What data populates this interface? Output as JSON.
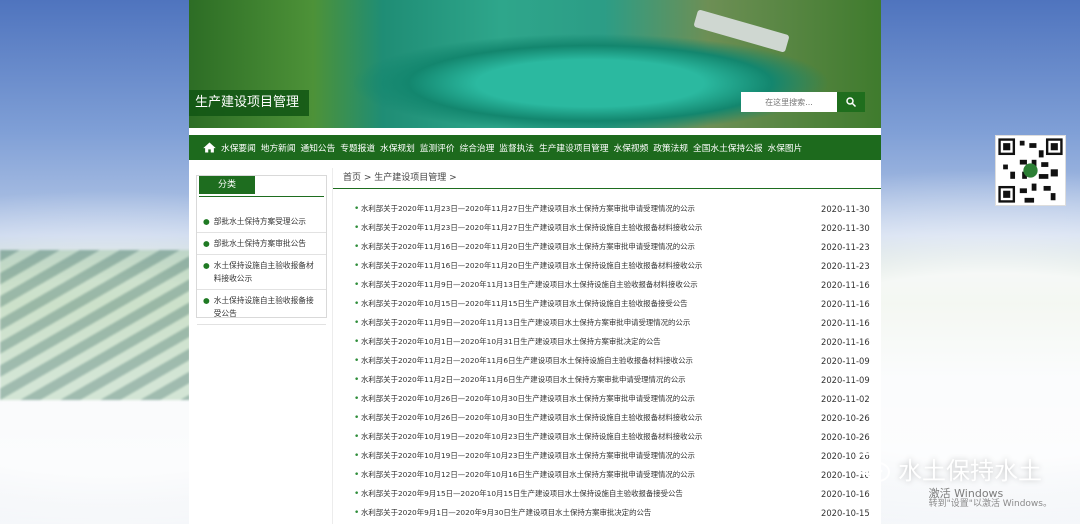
{
  "site": {
    "title": "生产建设项目管理",
    "search_placeholder": "在这里搜索...",
    "search_button_label": "🔍"
  },
  "nav": {
    "items": [
      {
        "label": "水保要闻"
      },
      {
        "label": "地方新闻"
      },
      {
        "label": "通知公告"
      },
      {
        "label": "专题报道"
      },
      {
        "label": "水保规划"
      },
      {
        "label": "监测评价"
      },
      {
        "label": "综合治理"
      },
      {
        "label": "监督执法"
      },
      {
        "label": "生产建设项目管理"
      },
      {
        "label": "水保视频"
      },
      {
        "label": "政策法规"
      },
      {
        "label": "全国水土保持公报"
      },
      {
        "label": "水保图片"
      }
    ]
  },
  "sidebar": {
    "header": "分类",
    "items": [
      {
        "label": "部批水土保持方案受理公示"
      },
      {
        "label": "部批水土保持方案审批公告"
      },
      {
        "label": "水土保持设施自主验收报备材料接收公示"
      },
      {
        "label": "水土保持设施自主验收报备接受公告"
      }
    ]
  },
  "breadcrumb": "首页 > 生产建设项目管理 >",
  "news": [
    {
      "title": "水利部关于2020年11月23日—2020年11月27日生产建设项目水土保持方案审批申请受理情况的公示",
      "date": "2020-11-30"
    },
    {
      "title": "水利部关于2020年11月23日—2020年11月27日生产建设项目水土保持设施自主验收报备材料接收公示",
      "date": "2020-11-30"
    },
    {
      "title": "水利部关于2020年11月16日—2020年11月20日生产建设项目水土保持方案审批申请受理情况的公示",
      "date": "2020-11-23"
    },
    {
      "title": "水利部关于2020年11月16日—2020年11月20日生产建设项目水土保持设施自主验收报备材料接收公示",
      "date": "2020-11-23"
    },
    {
      "title": "水利部关于2020年11月9日—2020年11月13日生产建设项目水土保持设施自主验收报备材料接收公示",
      "date": "2020-11-16"
    },
    {
      "title": "水利部关于2020年10月15日—2020年11月15日生产建设项目水土保持设施自主验收报备接受公告",
      "date": "2020-11-16"
    },
    {
      "title": "水利部关于2020年11月9日—2020年11月13日生产建设项目水土保持方案审批申请受理情况的公示",
      "date": "2020-11-16"
    },
    {
      "title": "水利部关于2020年10月1日—2020年10月31日生产建设项目水土保持方案审批决定的公告",
      "date": "2020-11-16"
    },
    {
      "title": "水利部关于2020年11月2日—2020年11月6日生产建设项目水土保持设施自主验收报备材料接收公示",
      "date": "2020-11-09"
    },
    {
      "title": "水利部关于2020年11月2日—2020年11月6日生产建设项目水土保持方案审批申请受理情况的公示",
      "date": "2020-11-09"
    },
    {
      "title": "水利部关于2020年10月26日—2020年10月30日生产建设项目水土保持方案审批申请受理情况的公示",
      "date": "2020-11-02"
    },
    {
      "title": "水利部关于2020年10月26日—2020年10月30日生产建设项目水土保持设施自主验收报备材料接收公示",
      "date": "2020-10-26"
    },
    {
      "title": "水利部关于2020年10月19日—2020年10月23日生产建设项目水土保持设施自主验收报备材料接收公示",
      "date": "2020-10-26"
    },
    {
      "title": "水利部关于2020年10月19日—2020年10月23日生产建设项目水土保持方案审批申请受理情况的公示",
      "date": "2020-10-26"
    },
    {
      "title": "水利部关于2020年10月12日—2020年10月16日生产建设项目水土保持方案审批申请受理情况的公示",
      "date": "2020-10-16"
    },
    {
      "title": "水利部关于2020年9月15日—2020年10月15日生产建设项目水土保持设施自主验收报备接受公告",
      "date": "2020-10-16"
    },
    {
      "title": "水利部关于2020年9月1日—2020年9月30日生产建设项目水土保持方案审批决定的公告",
      "date": "2020-10-15"
    }
  ],
  "watermark": {
    "text": "水土保持水土",
    "activate_line1": "激活 Windows",
    "activate_line2": "转到\"设置\"以激活 Windows。"
  },
  "colors": {
    "brand_green": "#1d6a1d",
    "bullet_green": "#2e8d3a"
  },
  "icons": {
    "home": "home-icon",
    "search": "search-icon",
    "qr": "qr-code-icon",
    "watermark": "wechat-icon"
  }
}
